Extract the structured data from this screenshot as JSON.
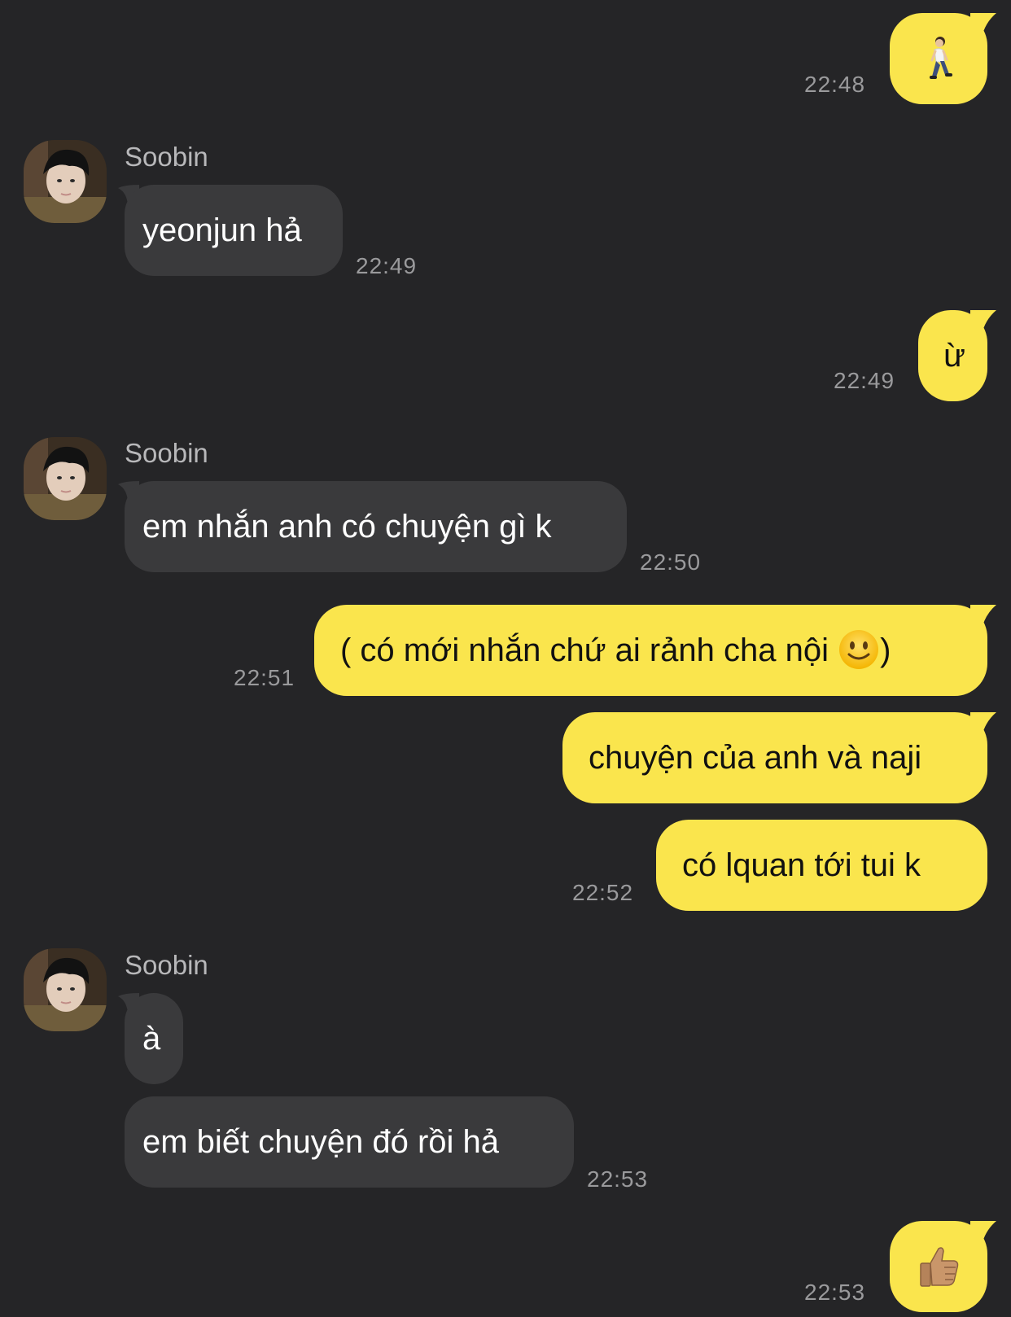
{
  "contact": {
    "name": "Soobin"
  },
  "messages": [
    {
      "from": "me",
      "text": "🚶",
      "icon": "walking-person-icon",
      "time": "22:48"
    },
    {
      "from": "contact",
      "text": "yeonjun hả",
      "time": "22:49"
    },
    {
      "from": "me",
      "text": "ừ",
      "time": "22:49"
    },
    {
      "from": "contact",
      "text": "em nhắn anh có chuyện gì k",
      "time": "22:50"
    },
    {
      "from": "me",
      "text": "( có mới nhắn chứ ai rảnh cha nội ",
      "emoji_icon": "slightly-smiling-face-icon",
      "text_end": ")",
      "time": "22:51"
    },
    {
      "from": "me",
      "text": "chuyện của anh và naji"
    },
    {
      "from": "me",
      "text": "có lquan tới tui k",
      "time": "22:52"
    },
    {
      "from": "contact",
      "text": "à"
    },
    {
      "from": "contact",
      "text": "em biết chuyện đó rồi hả",
      "time": "22:53"
    },
    {
      "from": "me",
      "text": "👍",
      "icon": "thumbs-up-icon",
      "time": "22:53"
    }
  ],
  "colors": {
    "background": "#252527",
    "outgoing_bubble": "#fae54d",
    "incoming_bubble": "#3a3a3c",
    "timestamp": "#9a9a9c"
  }
}
